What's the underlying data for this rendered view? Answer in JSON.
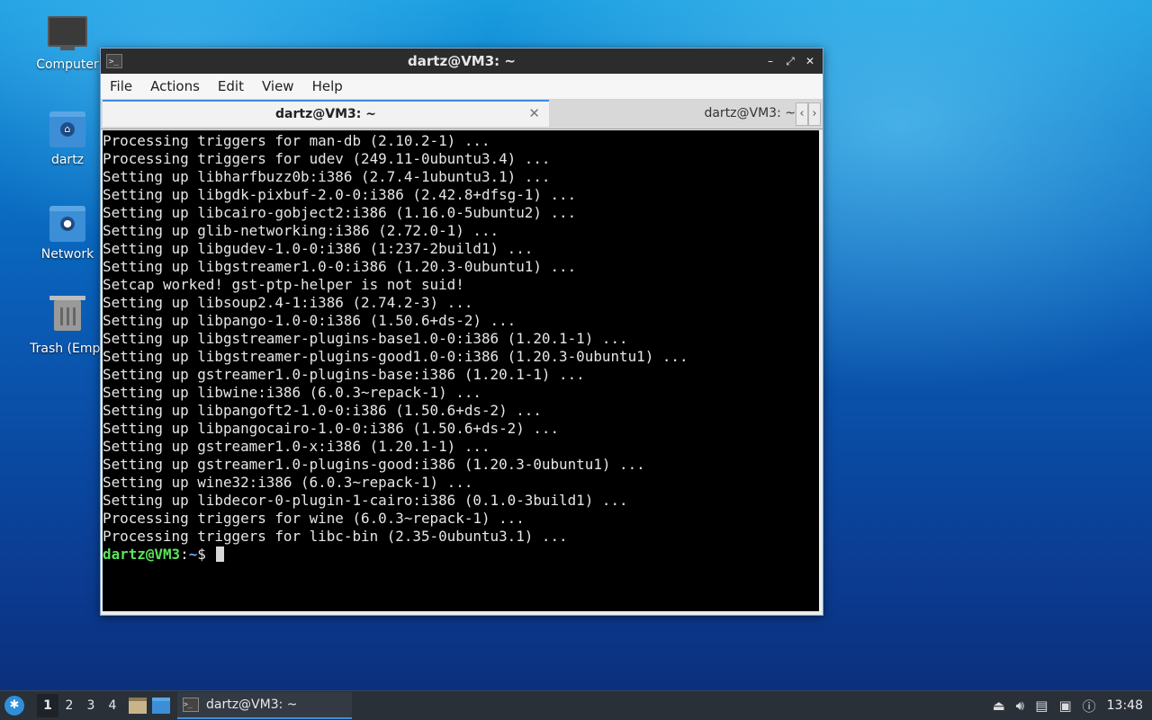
{
  "desktop": {
    "icons": [
      {
        "label": "Computer"
      },
      {
        "label": "dartz"
      },
      {
        "label": "Network"
      },
      {
        "label": "Trash (Empt"
      }
    ]
  },
  "window": {
    "title": "dartz@VM3: ~",
    "controls": {
      "minimize": "–",
      "maximize": "⤢",
      "close": "✕"
    },
    "menu": [
      "File",
      "Actions",
      "Edit",
      "View",
      "Help"
    ],
    "tabs": [
      {
        "label": "dartz@VM3: ~",
        "active": true,
        "close": "✕"
      },
      {
        "label": "dartz@VM3: ~",
        "active": false
      }
    ],
    "tab_scroll": {
      "left": "‹",
      "right": "›"
    }
  },
  "terminal": {
    "lines": [
      "Processing triggers for man-db (2.10.2-1) ...",
      "Processing triggers for udev (249.11-0ubuntu3.4) ...",
      "Setting up libharfbuzz0b:i386 (2.7.4-1ubuntu3.1) ...",
      "Setting up libgdk-pixbuf-2.0-0:i386 (2.42.8+dfsg-1) ...",
      "Setting up libcairo-gobject2:i386 (1.16.0-5ubuntu2) ...",
      "Setting up glib-networking:i386 (2.72.0-1) ...",
      "Setting up libgudev-1.0-0:i386 (1:237-2build1) ...",
      "Setting up libgstreamer1.0-0:i386 (1.20.3-0ubuntu1) ...",
      "Setcap worked! gst-ptp-helper is not suid!",
      "Setting up libsoup2.4-1:i386 (2.74.2-3) ...",
      "Setting up libpango-1.0-0:i386 (1.50.6+ds-2) ...",
      "Setting up libgstreamer-plugins-base1.0-0:i386 (1.20.1-1) ...",
      "Setting up libgstreamer-plugins-good1.0-0:i386 (1.20.3-0ubuntu1) ...",
      "Setting up gstreamer1.0-plugins-base:i386 (1.20.1-1) ...",
      "Setting up libwine:i386 (6.0.3~repack-1) ...",
      "Setting up libpangoft2-1.0-0:i386 (1.50.6+ds-2) ...",
      "Setting up libpangocairo-1.0-0:i386 (1.50.6+ds-2) ...",
      "Setting up gstreamer1.0-x:i386 (1.20.1-1) ...",
      "Setting up gstreamer1.0-plugins-good:i386 (1.20.3-0ubuntu1) ...",
      "Setting up wine32:i386 (6.0.3~repack-1) ...",
      "Setting up libdecor-0-plugin-1-cairo:i386 (0.1.0-3build1) ...",
      "Processing triggers for wine (6.0.3~repack-1) ...",
      "Processing triggers for libc-bin (2.35-0ubuntu3.1) ..."
    ],
    "prompt": {
      "user_host": "dartz@VM3",
      "sep": ":",
      "path": "~",
      "symbol": "$ "
    }
  },
  "taskbar": {
    "workspaces": [
      "1",
      "2",
      "3",
      "4"
    ],
    "active_workspace": "1",
    "task_title": "dartz@VM3: ~",
    "clock": "13:48",
    "colors": {
      "accent": "#3d8ee0"
    }
  }
}
